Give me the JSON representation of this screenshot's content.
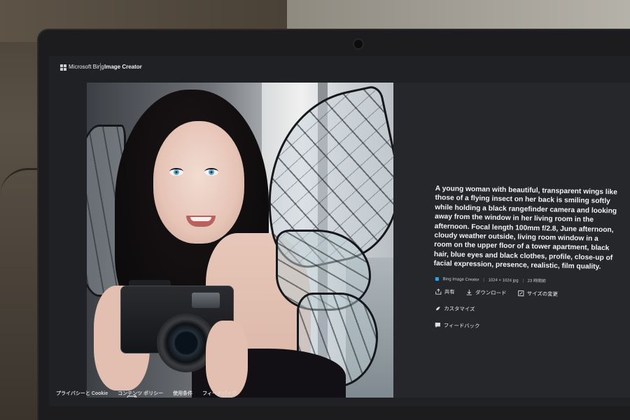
{
  "header": {
    "brand": "Microsoft Bing",
    "app_title": "Image Creator"
  },
  "image": {
    "icon": "image-reload-icon"
  },
  "details": {
    "prompt": "A young woman with beautiful, transparent wings like those of a flying insect on her back is smiling softly while holding a black rangefinder camera and looking away from the window in her living room in the afternoon. Focal length 100mm f/2.8, June afternoon, cloudy weather outside, living room window in a room on the upper floor of a tower apartment, black hair, blue eyes and black clothes, profile, close-up of facial expression, presence, realistic, film quality.",
    "source": "Bing Image Creator",
    "resolution": "1024 × 1024 jpg",
    "age": "23 時間前",
    "actions": [
      {
        "label": "共有",
        "icon": "share-icon"
      },
      {
        "label": "ダウンロード",
        "icon": "download-icon"
      },
      {
        "label": "サイズの変更",
        "icon": "resize-icon"
      },
      {
        "label": "カスタマイズ",
        "icon": "customize-icon"
      },
      {
        "label": "フィードバック",
        "icon": "feedback-icon"
      }
    ]
  },
  "footer": {
    "links": [
      "プライバシーと Cookie",
      "コンテンツ ポリシー",
      "使用条件",
      "フィードバック"
    ]
  },
  "colors": {
    "screen_bg": "#202124",
    "panel_bg": "#25272b",
    "accent": "#3aa0e0"
  }
}
